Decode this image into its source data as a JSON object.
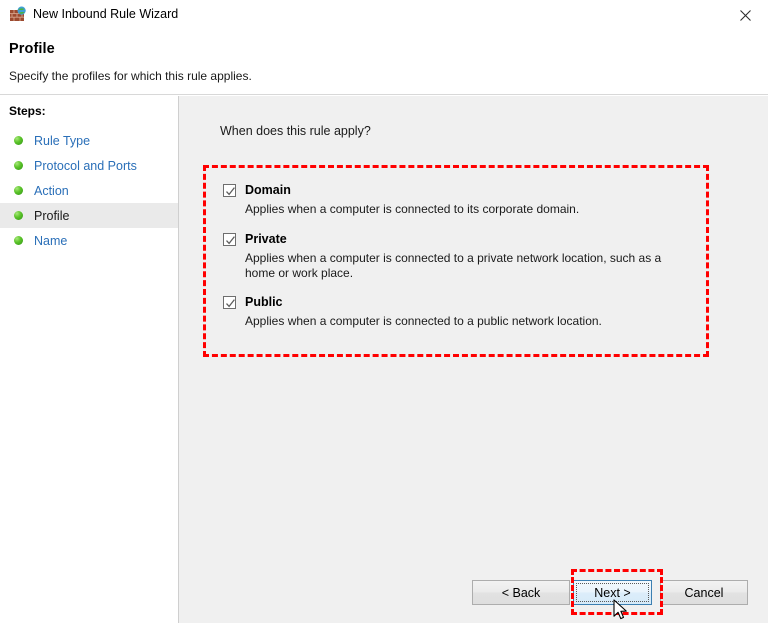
{
  "window": {
    "title": "New Inbound Rule Wizard",
    "icon": "firewall-icon",
    "close_label": "✕"
  },
  "header": {
    "title": "Profile",
    "subtitle": "Specify the profiles for which this rule applies."
  },
  "sidebar": {
    "label": "Steps:",
    "items": [
      {
        "label": "Rule Type",
        "active": false
      },
      {
        "label": "Protocol and Ports",
        "active": false
      },
      {
        "label": "Action",
        "active": false
      },
      {
        "label": "Profile",
        "active": true
      },
      {
        "label": "Name",
        "active": false
      }
    ]
  },
  "content": {
    "question": "When does this rule apply?",
    "options": [
      {
        "label": "Domain",
        "checked": true,
        "description": "Applies when a computer is connected to its corporate domain."
      },
      {
        "label": "Private",
        "checked": true,
        "description": "Applies when a computer is connected to a private network location, such as a home or work place."
      },
      {
        "label": "Public",
        "checked": true,
        "description": "Applies when a computer is connected to a public network location."
      }
    ]
  },
  "buttons": {
    "back": "< Back",
    "next": "Next >",
    "cancel": "Cancel"
  },
  "annotations": {
    "accent_color": "#ff0000",
    "profiles_box": "profiles-group-highlight",
    "next_box": "next-button-highlight"
  }
}
